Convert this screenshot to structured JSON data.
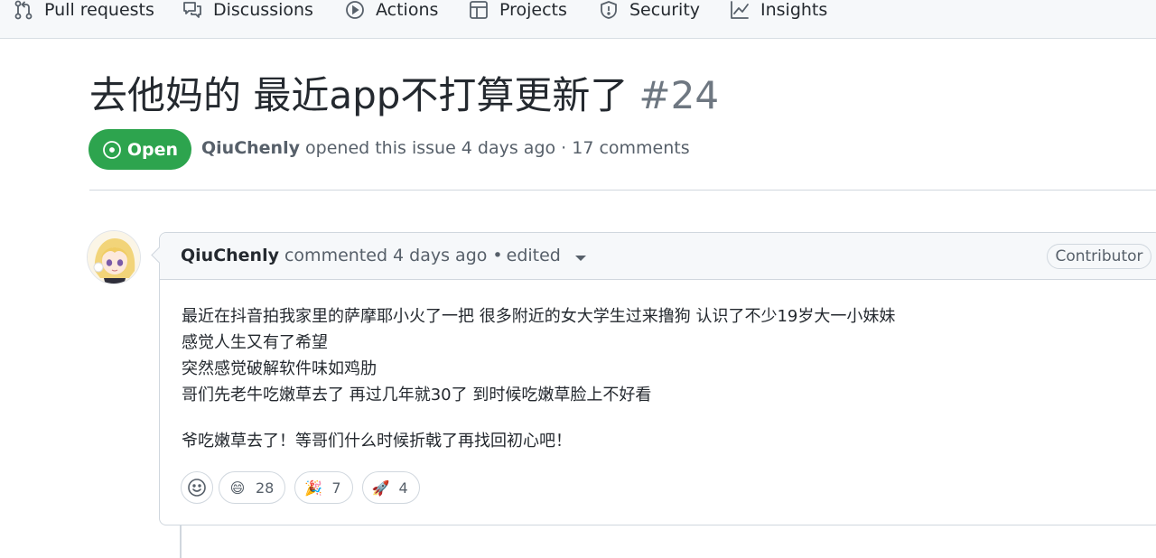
{
  "repo_nav": {
    "items": [
      {
        "label": "Pull requests",
        "icon": "pull-request-icon"
      },
      {
        "label": "Discussions",
        "icon": "discussions-icon"
      },
      {
        "label": "Actions",
        "icon": "actions-play-icon"
      },
      {
        "label": "Projects",
        "icon": "projects-table-icon"
      },
      {
        "label": "Security",
        "icon": "shield-icon"
      },
      {
        "label": "Insights",
        "icon": "graph-icon"
      }
    ]
  },
  "issue": {
    "title": "去他妈的 最近app不打算更新了",
    "number": "#24",
    "state": "Open",
    "author": "QiuChenly",
    "opened_text": "opened this issue 4 days ago · 17 comments"
  },
  "comment": {
    "author": "QiuChenly",
    "meta": "commented 4 days ago •",
    "edited": "edited",
    "role": "Contributor",
    "body_lines": [
      "最近在抖音拍我家里的萨摩耶小火了一把 很多附近的女大学生过来撸狗 认识了不少19岁大一小妹妹",
      "感觉人生又有了希望",
      "突然感觉破解软件味如鸡肋",
      "哥们先老牛吃嫩草去了 再过几年就30了 到时候吃嫩草脸上不好看"
    ],
    "closing_line": "爷吃嫩草去了！等哥们什么时候折戟了再找回初心吧！",
    "reactions": [
      {
        "emoji": "😄",
        "count": "28",
        "icon": "smile-emoji-icon"
      },
      {
        "emoji": "🎉",
        "count": "7",
        "icon": "tada-emoji-icon"
      },
      {
        "emoji": "🚀",
        "count": "4",
        "icon": "rocket-emoji-icon"
      }
    ]
  },
  "colors": {
    "open_green": "#2da44e",
    "text": "#24292f",
    "muted": "#57606a",
    "border": "#d0d7de"
  }
}
